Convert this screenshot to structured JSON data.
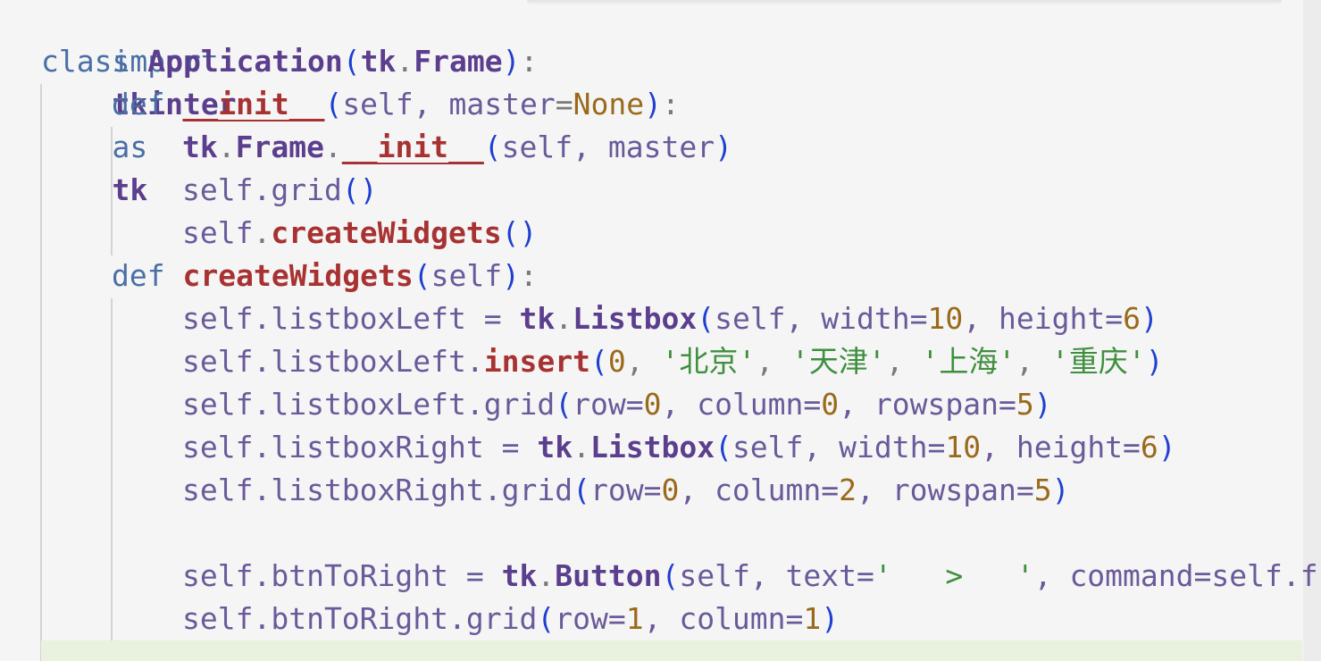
{
  "code": {
    "l1": {
      "kw_import": "import",
      "mod": "tkinter",
      "kw_as": "as",
      "alias": "tk"
    },
    "l2": {
      "kw_class": "class",
      "name": "Application",
      "p1": "(",
      "base_mod": "tk",
      "dot": ".",
      "base": "Frame",
      "p2": ")",
      "colon": ":"
    },
    "l3": {
      "kw_def": "def",
      "name": "__init__",
      "p1": "(",
      "args1": "self, master",
      "eq": "=",
      "none": "None",
      "p2": ")",
      "colon": ":"
    },
    "l4": {
      "mod": "tk",
      "dot1": ".",
      "cls": "Frame",
      "dot2": ".",
      "fn": "__init__",
      "p1": "(",
      "args": "self, master",
      "p2": ")"
    },
    "l5": {
      "text": "self.grid",
      "p1": "(",
      "p2": ")"
    },
    "l6": {
      "self": "self",
      "dot": ".",
      "fn": "createWidgets",
      "p1": "(",
      "p2": ")"
    },
    "l7": {
      "kw_def": "def",
      "name": "createWidgets",
      "p1": "(",
      "args": "self",
      "p2": ")",
      "colon": ":"
    },
    "l8": {
      "lhs": "self.listboxLeft = ",
      "mod": "tk",
      "dot": ".",
      "cls": "Listbox",
      "p1": "(",
      "a1": "self, width=",
      "n1": "10",
      "a2": ", height=",
      "n2": "6",
      "p2": ")"
    },
    "l9": {
      "lhs": "self.listboxLeft.",
      "fn": "insert",
      "p1": "(",
      "n1": "0",
      "c1": ", ",
      "s1": "'北京'",
      "c2": ", ",
      "s2": "'天津'",
      "c3": ", ",
      "s3": "'上海'",
      "c4": ", ",
      "s4": "'重庆'",
      "p2": ")"
    },
    "l10": {
      "lhs": "self.listboxLeft.grid",
      "p1": "(",
      "a1": "row=",
      "n1": "0",
      "a2": ", column=",
      "n2": "0",
      "a3": ", rowspan=",
      "n3": "5",
      "p2": ")"
    },
    "l11": {
      "lhs": "self.listboxRight = ",
      "mod": "tk",
      "dot": ".",
      "cls": "Listbox",
      "p1": "(",
      "a1": "self, width=",
      "n1": "10",
      "a2": ", height=",
      "n2": "6",
      "p2": ")"
    },
    "l12": {
      "lhs": "self.listboxRight.grid",
      "p1": "(",
      "a1": "row=",
      "n1": "0",
      "a2": ", column=",
      "n2": "2",
      "a3": ", rowspan=",
      "n3": "5",
      "p2": ")"
    },
    "l14": {
      "lhs": "self.btnToRight = ",
      "mod": "tk",
      "dot": ".",
      "cls": "Button",
      "p1": "(",
      "a1": "self, text=",
      "s1": "'   >   '",
      "a2": ", command=self.f"
    },
    "l15": {
      "lhs": "self.btnToRight.grid",
      "p1": "(",
      "a1": "row=",
      "n1": "1",
      "a2": ", column=",
      "n2": "1",
      "p2": ")"
    }
  },
  "colors": {
    "background": "#f5f5f5",
    "keyword": "#4a6fa5",
    "function": "#a83232",
    "class": "#5b3e8d",
    "string": "#3f8f3f",
    "number": "#9a6a1b",
    "paren": "#1f3fd1"
  }
}
